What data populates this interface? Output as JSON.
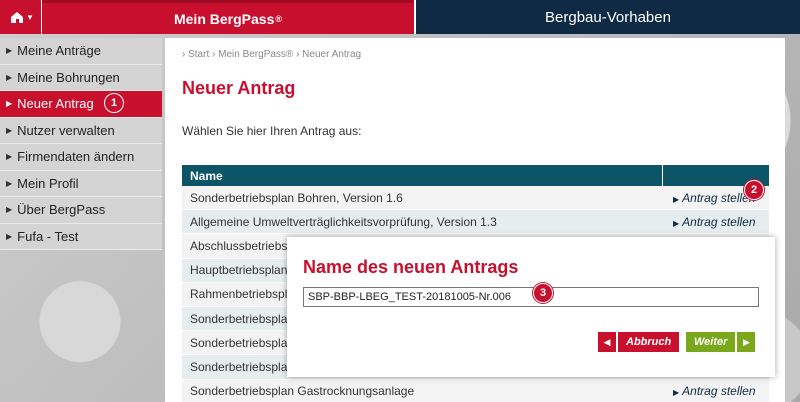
{
  "header": {
    "home_caret": "▾",
    "tab_bergpass": "Mein BergPass",
    "tab_bergpass_mark": "®",
    "tab_vorhaben": "Bergbau-Vorhaben"
  },
  "sidebar": {
    "items": [
      {
        "label": "Meine Anträge"
      },
      {
        "label": "Meine Bohrungen"
      },
      {
        "label": "Neuer Antrag"
      },
      {
        "label": "Nutzer verwalten"
      },
      {
        "label": "Firmendaten ändern"
      },
      {
        "label": "Mein Profil"
      },
      {
        "label": "Über BergPass"
      },
      {
        "label": "Fufa - Test"
      }
    ]
  },
  "main": {
    "breadcrumb": "› Start  › Mein BergPass®  › Neuer Antrag",
    "title": "Neuer Antrag",
    "intro": "Wählen Sie hier Ihren Antrag aus:",
    "table": {
      "header_name": "Name",
      "header_action": "",
      "rows": [
        {
          "name": "Sonderbetriebsplan Bohren, Version 1.6",
          "action": "Antrag stellen"
        },
        {
          "name": "Allgemeine Umweltverträglichkeitsvorprüfung, Version 1.3",
          "action": "Antrag stellen"
        },
        {
          "name": "Abschlussbetriebsplan",
          "action": ""
        },
        {
          "name": "Hauptbetriebsplan",
          "action": ""
        },
        {
          "name": "Rahmenbetriebsplan",
          "action": ""
        },
        {
          "name": "Sonderbetriebsplan",
          "action": ""
        },
        {
          "name": "Sonderbetriebsplan",
          "action": ""
        },
        {
          "name": "Sonderbetriebsplan",
          "action": ""
        },
        {
          "name": "Sonderbetriebsplan Gastrocknungsanlage",
          "action": "Antrag stellen"
        }
      ]
    }
  },
  "modal": {
    "title": "Name des neuen Antrags",
    "input_value": "SBP-BBP-LBEG_TEST-20181005-Nr.006",
    "cancel_label": "Abbruch",
    "next_label": "Weiter"
  },
  "badges": [
    "1",
    "2",
    "3"
  ],
  "colors": {
    "brand_red": "#c8102e",
    "navy": "#0f2a45",
    "teal_header": "#0b5567",
    "green_button": "#7aa81a"
  }
}
